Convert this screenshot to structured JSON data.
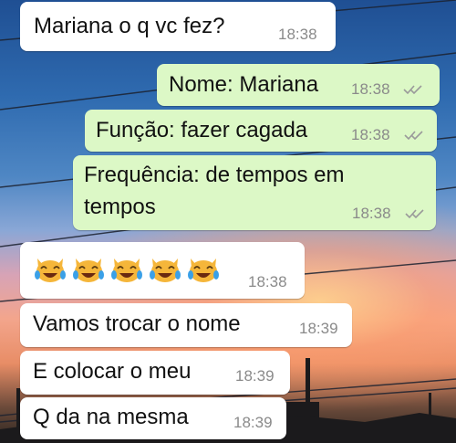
{
  "messages": [
    {
      "direction": "in",
      "text": "Mariana o q vc fez?",
      "time": "18:38"
    },
    {
      "direction": "out",
      "text": "Nome: Mariana",
      "time": "18:38",
      "status_icon": "double-check-icon"
    },
    {
      "direction": "out",
      "text": "Função: fazer cagada",
      "time": "18:38",
      "status_icon": "double-check-icon"
    },
    {
      "direction": "out",
      "text_line1": "Frequência: de tempos em",
      "text_line2": "tempos",
      "time": "18:38",
      "status_icon": "double-check-icon"
    },
    {
      "direction": "in",
      "emoji": "crying-laughing-cat-emoji",
      "emoji_count": 5,
      "time": "18:38"
    },
    {
      "direction": "in",
      "text": "Vamos trocar o nome",
      "time": "18:39"
    },
    {
      "direction": "in",
      "text": "E colocar o meu",
      "time": "18:39"
    },
    {
      "direction": "in",
      "text": "Q da na mesma",
      "time": "18:39"
    }
  ],
  "colors": {
    "incoming_bubble": "#ffffff",
    "outgoing_bubble": "#dcf8c6",
    "timestamp": "#8a8a8a",
    "tick": "#9a9a9a"
  }
}
